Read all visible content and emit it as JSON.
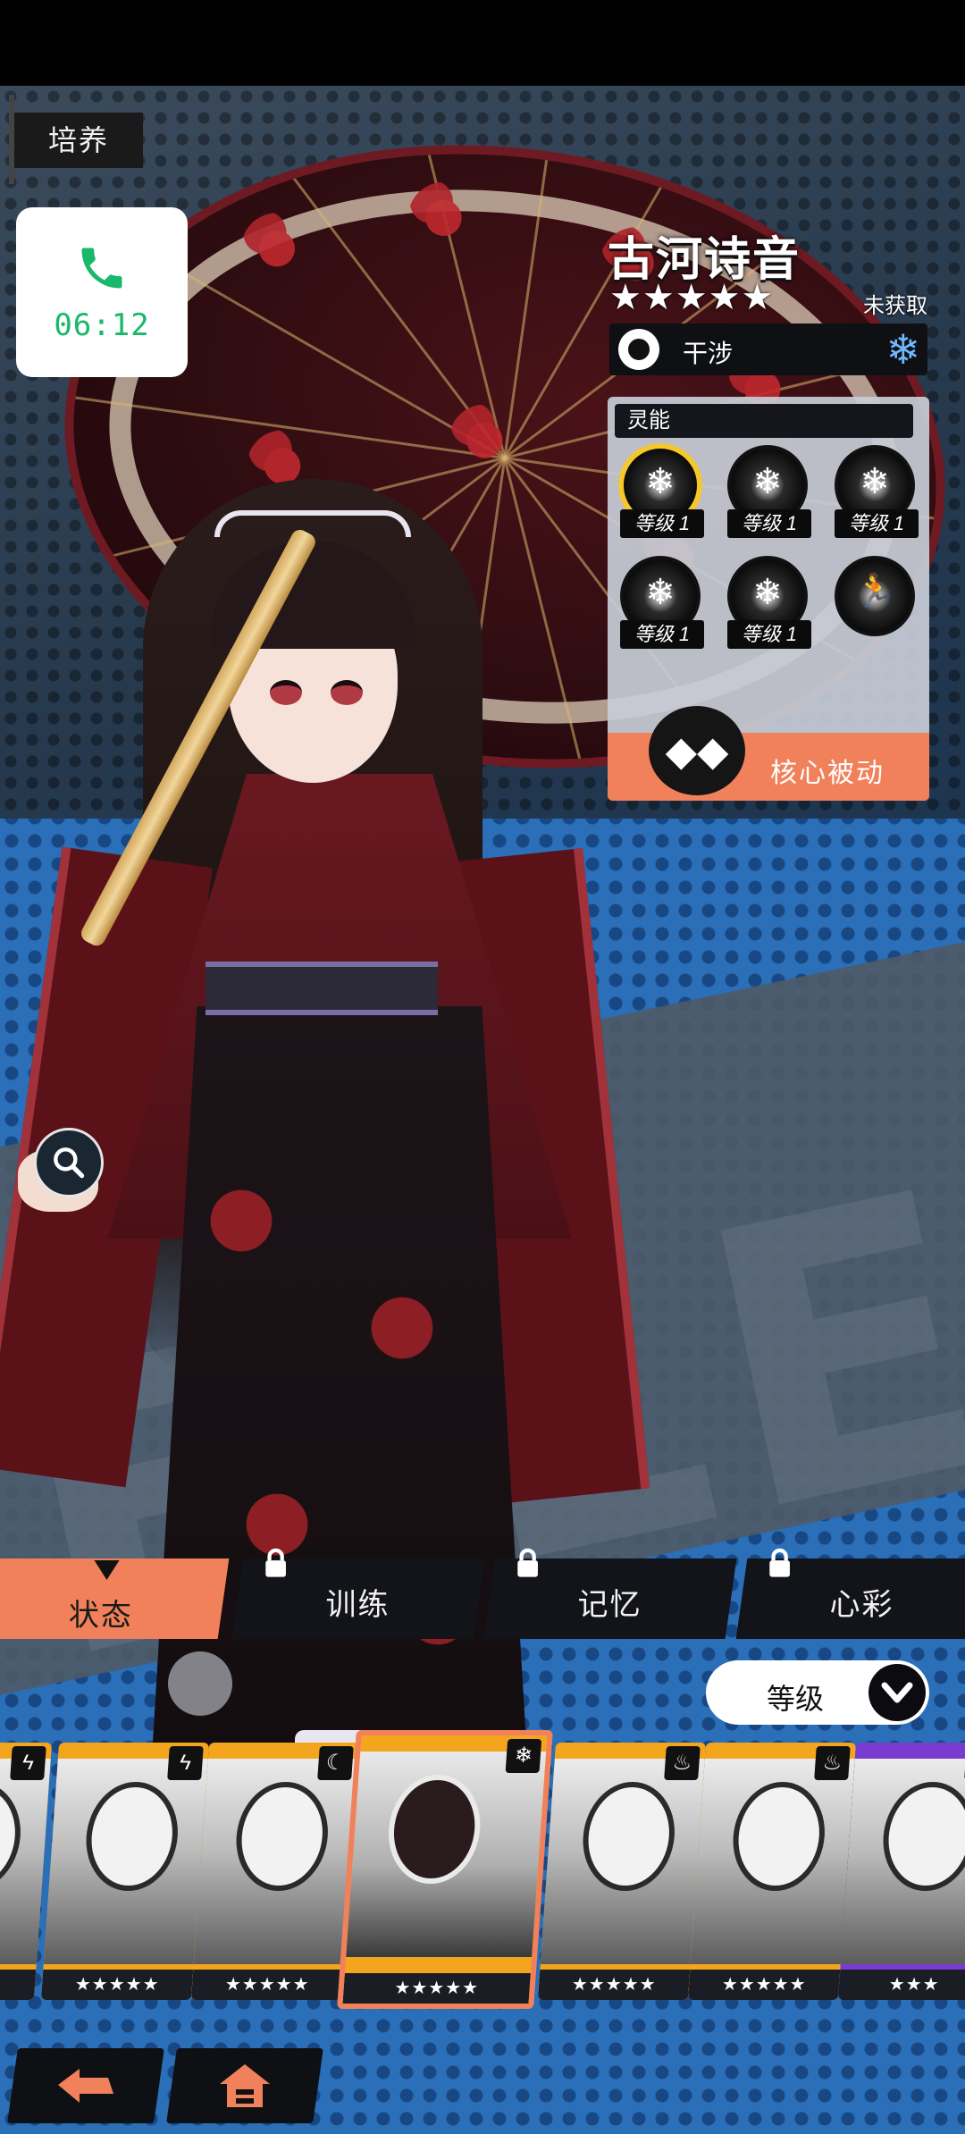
{
  "header": {
    "section_tag": "培养"
  },
  "call_widget": {
    "time": "06:12",
    "icon": "phone-icon",
    "accent": "#19b86a"
  },
  "character": {
    "name": "古河诗音",
    "stars": "★★★★★",
    "rarity": 5,
    "status": "未获取",
    "type_label": "干涉",
    "element_icon": "snowflake-icon",
    "element_color": "#6fb8ff"
  },
  "psi_panel": {
    "title": "灵能",
    "skills": [
      {
        "level": "等级 1",
        "icon": "snow-tree-icon"
      },
      {
        "level": "等级 1",
        "icon": "ice-shard-icon"
      },
      {
        "level": "等级 1",
        "icon": "snow-slash-icon"
      },
      {
        "level": "等级 1",
        "icon": "snow-rose-icon"
      },
      {
        "level": "等级 1",
        "icon": "snow-moon-icon"
      },
      {
        "icon": "dodge-icon"
      }
    ],
    "core_label": "核心被动",
    "core_color": "#f1815a"
  },
  "tabs": [
    {
      "label": "状态",
      "active": true,
      "locked": false
    },
    {
      "label": "训练",
      "active": false,
      "locked": true
    },
    {
      "label": "记忆",
      "active": false,
      "locked": true
    },
    {
      "label": "心彩",
      "active": false,
      "locked": true
    }
  ],
  "sort": {
    "label": "等级"
  },
  "roster": [
    {
      "stars": "★★★★★",
      "element": "bolt-icon"
    },
    {
      "stars": "★★★★★",
      "element": "bolt-icon"
    },
    {
      "stars": "★★★★★",
      "element": "moon-icon"
    },
    {
      "stars": "★★★★★",
      "element": "snowflake-icon",
      "selected": true
    },
    {
      "stars": "★★★★★",
      "element": "flame-icon"
    },
    {
      "stars": "★★★★★",
      "element": "flame-icon"
    },
    {
      "stars": "★★★",
      "element": "flame-icon"
    }
  ],
  "background_text": "FILE",
  "footer": {
    "back_icon": "back-arrow-icon",
    "home_icon": "home-icon"
  }
}
